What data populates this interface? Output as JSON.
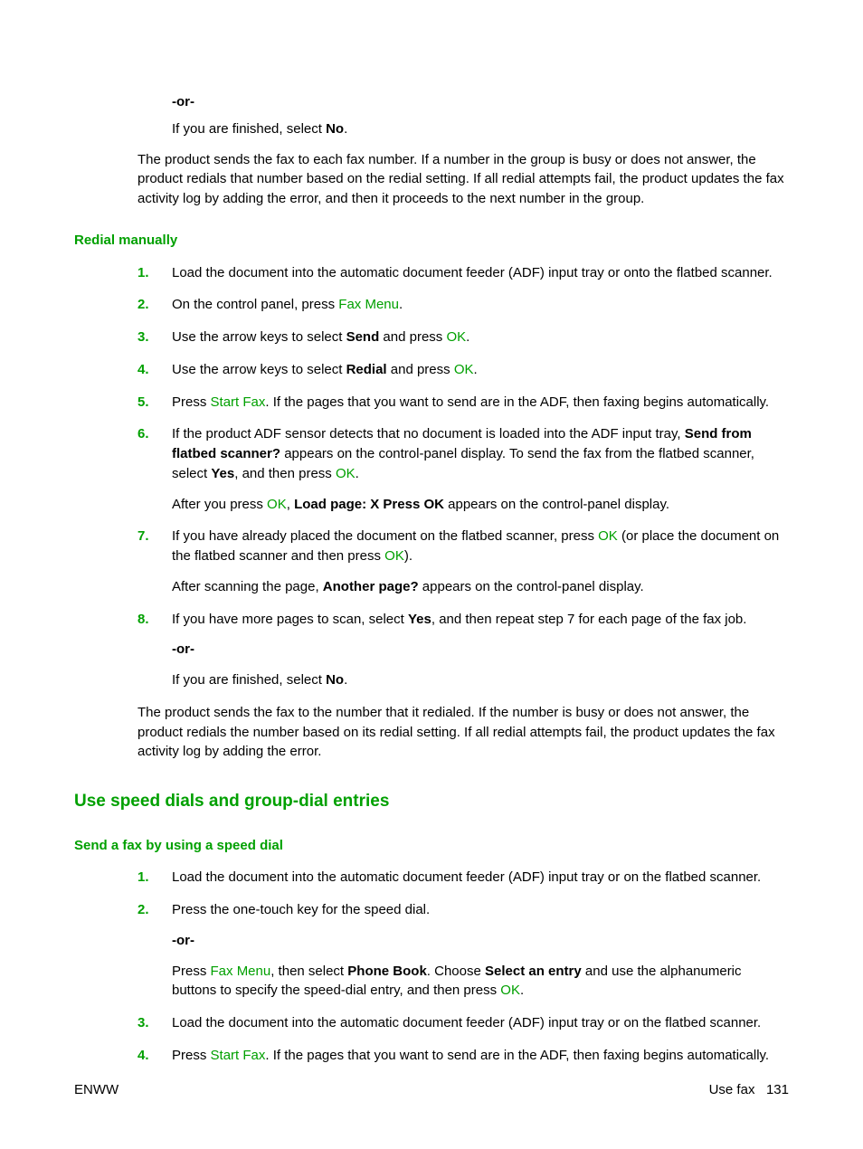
{
  "top": {
    "or": "-or-",
    "finished_pre": "If you are finished, select ",
    "finished_bold": "No",
    "finished_post": "."
  },
  "intro1": "The product sends the fax to each fax number. If a number in the group is busy or does not answer, the product redials that number based on the redial setting. If all redial attempts fail, the product updates the fax activity log by adding the error, and then it proceeds to the next number in the group.",
  "redial": {
    "heading": "Redial manually",
    "s1": "Load the document into the automatic document feeder (ADF) input tray or onto the flatbed scanner.",
    "s2_pre": "On the control panel, press ",
    "s2_kw": "Fax Menu",
    "s2_post": ".",
    "s3_pre": "Use the arrow keys to select ",
    "s3_bold": "Send",
    "s3_mid": " and press ",
    "s3_kw": "OK",
    "s3_post": ".",
    "s4_pre": "Use the arrow keys to select ",
    "s4_bold": "Redial",
    "s4_mid": " and press ",
    "s4_kw": "OK",
    "s4_post": ".",
    "s5_pre": "Press ",
    "s5_kw": "Start Fax",
    "s5_post": ". If the pages that you want to send are in the ADF, then faxing begins automatically.",
    "s6_pre": "If the product ADF sensor detects that no document is loaded into the ADF input tray, ",
    "s6_bold1": "Send from flatbed scanner?",
    "s6_mid1": " appears on the control-panel display. To send the fax from the flatbed scanner, select ",
    "s6_bold2": "Yes",
    "s6_mid2": ", and then press ",
    "s6_kw": "OK",
    "s6_post": ".",
    "s6b_pre": "After you press ",
    "s6b_kw": "OK",
    "s6b_mid": ", ",
    "s6b_bold": "Load page: X Press OK",
    "s6b_post": " appears on the control-panel display.",
    "s7_pre": "If you have already placed the document on the flatbed scanner, press ",
    "s7_kw1": "OK",
    "s7_mid": " (or place the document on the flatbed scanner and then press ",
    "s7_kw2": "OK",
    "s7_post": ").",
    "s7b_pre": "After scanning the page, ",
    "s7b_bold": "Another page?",
    "s7b_post": " appears on the control-panel display.",
    "s8_pre": "If you have more pages to scan, select ",
    "s8_bold": "Yes",
    "s8_post": ", and then repeat step 7 for each page of the fax job.",
    "s8_or": "-or-",
    "s8c_pre": "If you are finished, select ",
    "s8c_bold": "No",
    "s8c_post": "."
  },
  "intro2": "The product sends the fax to the number that it redialed. If the number is busy or does not answer, the product redials the number based on its redial setting. If all redial attempts fail, the product updates the fax activity log by adding the error.",
  "speed": {
    "h2": "Use speed dials and group-dial entries",
    "h3": "Send a fax by using a speed dial",
    "s1": "Load the document into the automatic document feeder (ADF) input tray or on the flatbed scanner.",
    "s2": "Press the one-touch key for the speed dial.",
    "s2_or": "-or-",
    "s2b_pre": "Press ",
    "s2b_kw1": "Fax Menu",
    "s2b_mid1": ", then select ",
    "s2b_bold1": "Phone Book",
    "s2b_mid2": ". Choose ",
    "s2b_bold2": "Select an entry",
    "s2b_mid3": " and use the alphanumeric buttons to specify the speed-dial entry, and then press ",
    "s2b_kw2": "OK",
    "s2b_post": ".",
    "s3": "Load the document into the automatic document feeder (ADF) input tray or on the flatbed scanner.",
    "s4_pre": "Press ",
    "s4_kw": "Start Fax",
    "s4_post": ". If the pages that you want to send are in the ADF, then faxing begins automatically."
  },
  "nums": {
    "n1": "1.",
    "n2": "2.",
    "n3": "3.",
    "n4": "4.",
    "n5": "5.",
    "n6": "6.",
    "n7": "7.",
    "n8": "8."
  },
  "footer": {
    "left": "ENWW",
    "right_label": "Use fax",
    "right_page": "131"
  }
}
